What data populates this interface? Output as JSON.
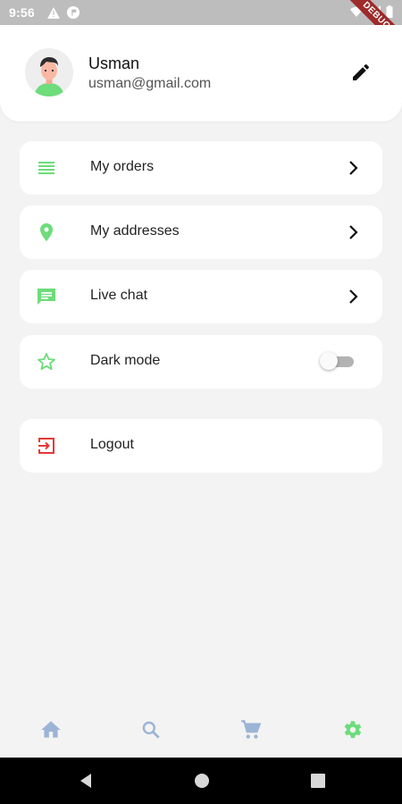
{
  "status_bar": {
    "time": "9:56",
    "debug_label": "DEBUG"
  },
  "profile": {
    "name": "Usman",
    "email": "usman@gmail.com"
  },
  "menu": {
    "items": [
      {
        "label": "My orders",
        "icon": "list-icon"
      },
      {
        "label": "My addresses",
        "icon": "location-pin-icon"
      },
      {
        "label": "Live chat",
        "icon": "chat-icon"
      },
      {
        "label": "Dark mode",
        "icon": "star-outline-icon",
        "toggle_on": false
      }
    ],
    "logout_label": "Logout"
  },
  "bottom_nav": {
    "items": [
      "home-icon",
      "search-icon",
      "cart-icon",
      "settings-icon"
    ],
    "active": "settings-icon"
  },
  "colors": {
    "accent": "#6ddc7b",
    "inactive_nav": "#9db4d6",
    "logout": "#e53935"
  }
}
